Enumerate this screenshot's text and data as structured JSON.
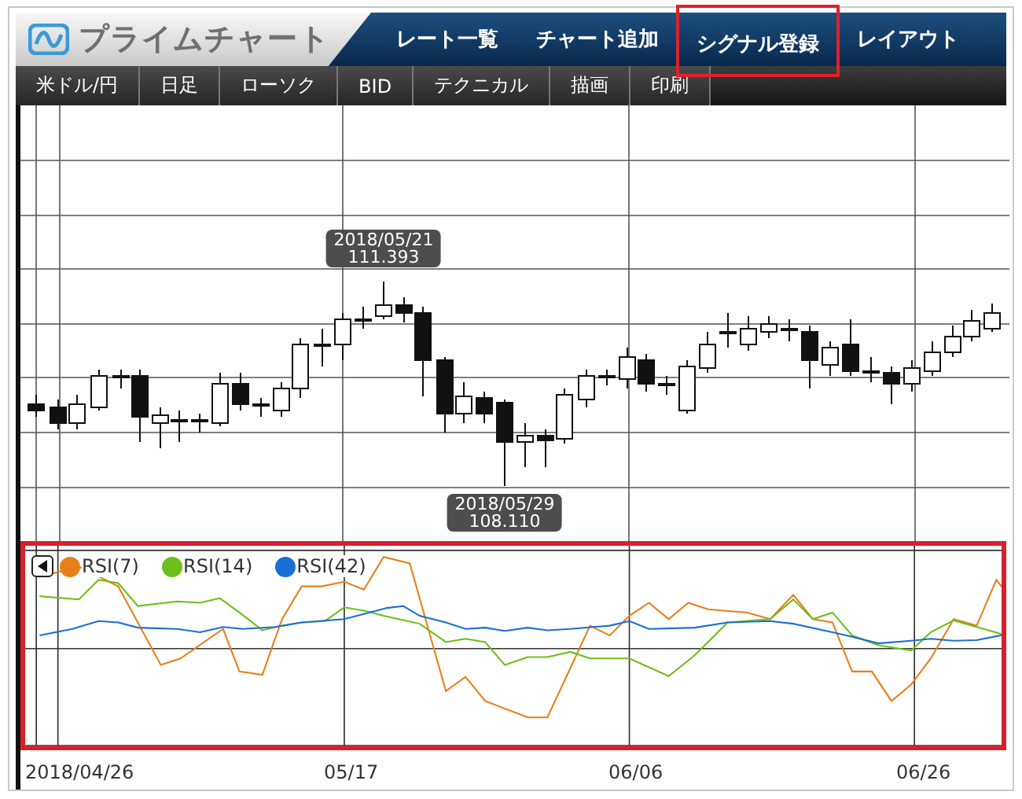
{
  "app": {
    "logo": "プライムチャート"
  },
  "nav": [
    {
      "label": "レート一覧",
      "highlighted": false
    },
    {
      "label": "チャート追加",
      "highlighted": false
    },
    {
      "label": "シグナル登録",
      "highlighted": true
    },
    {
      "label": "レイアウト",
      "highlighted": false
    }
  ],
  "toolbar": [
    "米ドル/円",
    "日足",
    "ローソク",
    "BID",
    "テクニカル",
    "描画",
    "印刷"
  ],
  "callouts": [
    {
      "kind": "high",
      "date": "2018/05/21",
      "price": "111.393"
    },
    {
      "kind": "low",
      "date": "2018/05/29",
      "price": "108.110"
    }
  ],
  "rsi": {
    "highlighted": true,
    "legend": [
      {
        "label": "RSI(7)",
        "color": "#e8801a"
      },
      {
        "label": "RSI(14)",
        "color": "#6cbf1a"
      },
      {
        "label": "RSI(42)",
        "color": "#1a6fd6"
      }
    ]
  },
  "x_axis": [
    "2018/04/26",
    "05/17",
    "06/06",
    "06/26"
  ]
}
